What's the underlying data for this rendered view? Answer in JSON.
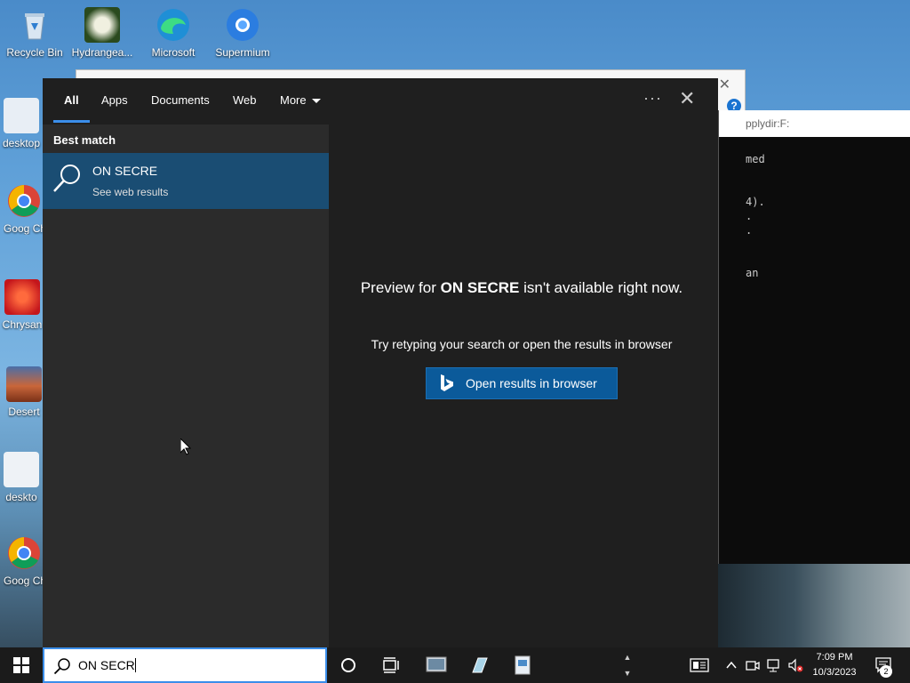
{
  "desktop": {
    "icons": [
      {
        "label": "Recycle Bin"
      },
      {
        "label": "Hydrangea..."
      },
      {
        "label": "Microsoft"
      },
      {
        "label": "Supermium"
      },
      {
        "label": "desktop"
      },
      {
        "label": "Goog Chron"
      },
      {
        "label": "Chrysan"
      },
      {
        "label": "Desert"
      },
      {
        "label": "deskto"
      },
      {
        "label": "Goog Chron"
      }
    ]
  },
  "background_windows": {
    "cmd_title": "pplydir:F:",
    "cmd_lines": [
      "med",
      "4).",
      ".",
      ".",
      "an"
    ]
  },
  "search": {
    "tabs": [
      {
        "label": "All"
      },
      {
        "label": "Apps"
      },
      {
        "label": "Documents"
      },
      {
        "label": "Web"
      },
      {
        "label": "More"
      }
    ],
    "more_options": "···",
    "best_match_header": "Best match",
    "result": {
      "title": "ON SECRE",
      "subtitle": "See web results"
    },
    "preview": {
      "prefix": "Preview for ",
      "query": "ON SECRE",
      "suffix": " isn't available right now.",
      "hint": "Try retyping your search or open the results in browser",
      "button_label": "Open results in browser"
    }
  },
  "taskbar": {
    "search_value": "ON SECR",
    "time": "7:09 PM",
    "date": "10/3/2023",
    "notification_count": "2"
  },
  "colors": {
    "accent": "#3b8eea",
    "selected_row": "#1a4d73",
    "button": "#0b5a9a"
  }
}
